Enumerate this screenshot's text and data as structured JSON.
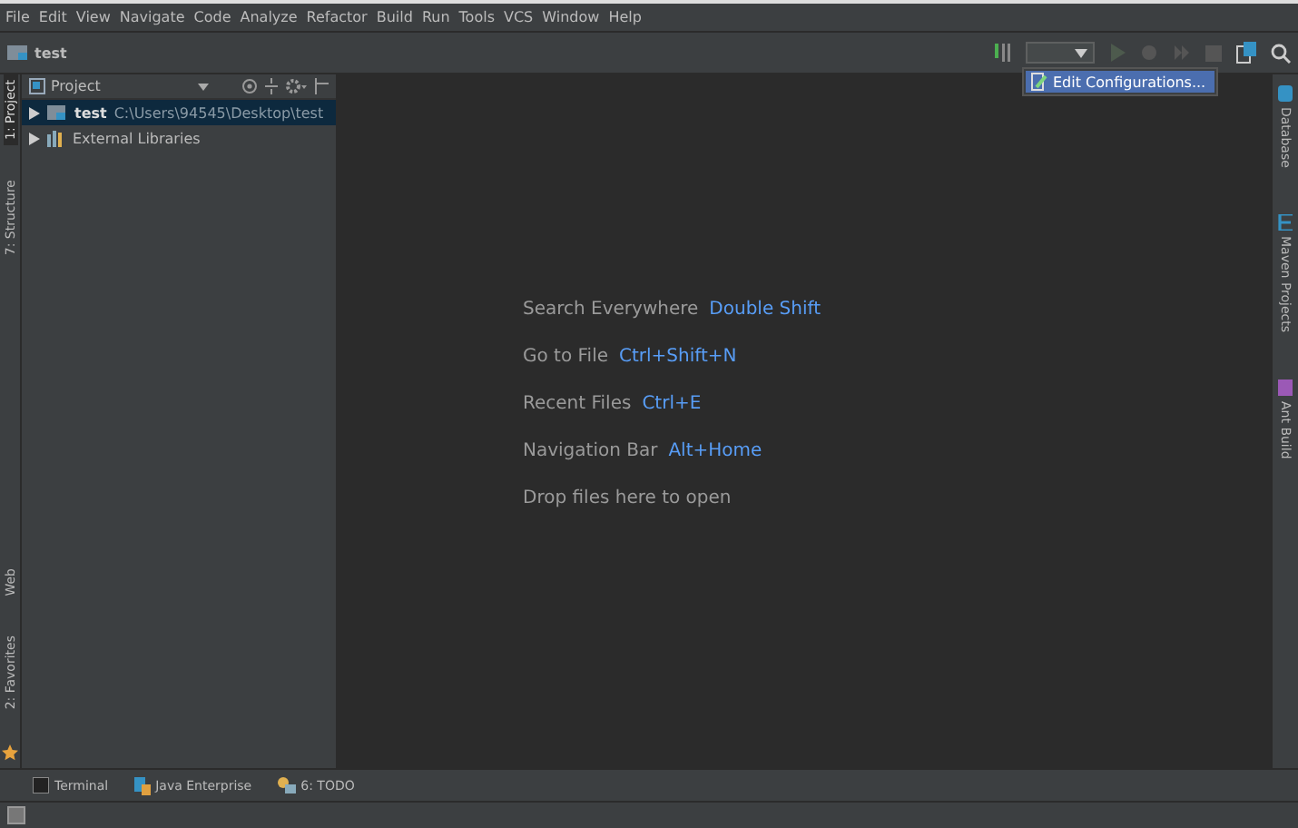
{
  "menu_bar": {
    "items": [
      "File",
      "Edit",
      "View",
      "Navigate",
      "Code",
      "Analyze",
      "Refactor",
      "Build",
      "Run",
      "Tools",
      "VCS",
      "Window",
      "Help"
    ]
  },
  "nav_bar": {
    "breadcrumb": "test"
  },
  "run_config": {
    "dropdown_open": true,
    "menu_items": [
      "Edit Configurations..."
    ]
  },
  "left_stripe": {
    "top": [
      {
        "label": "1: Project",
        "selected": true
      },
      {
        "label": "7: Structure",
        "selected": false
      }
    ],
    "bottom": [
      {
        "label": "Web",
        "selected": false
      },
      {
        "label": "2: Favorites",
        "selected": false
      }
    ]
  },
  "project_panel": {
    "title": "Project",
    "tree": [
      {
        "name": "test",
        "path": "C:\\Users\\94545\\Desktop\\test",
        "kind": "module",
        "selected": true
      },
      {
        "name": "External Libraries",
        "kind": "libraries",
        "selected": false
      }
    ]
  },
  "editor": {
    "hints": [
      {
        "label": "Search Everywhere",
        "shortcut": "Double Shift"
      },
      {
        "label": "Go to File",
        "shortcut": "Ctrl+Shift+N"
      },
      {
        "label": "Recent Files",
        "shortcut": "Ctrl+E"
      },
      {
        "label": "Navigation Bar",
        "shortcut": "Alt+Home"
      },
      {
        "label": "Drop files here to open"
      }
    ]
  },
  "right_stripe": {
    "items": [
      {
        "label": "Database",
        "kind": "database"
      },
      {
        "label": "Maven Projects",
        "kind": "maven"
      },
      {
        "label": "Ant Build",
        "kind": "ant"
      }
    ]
  },
  "bottom_bar": {
    "items": [
      {
        "label": "Terminal",
        "kind": "terminal"
      },
      {
        "label": "Java Enterprise",
        "kind": "enterprise"
      },
      {
        "label": "6: TODO",
        "kind": "todo"
      }
    ]
  }
}
